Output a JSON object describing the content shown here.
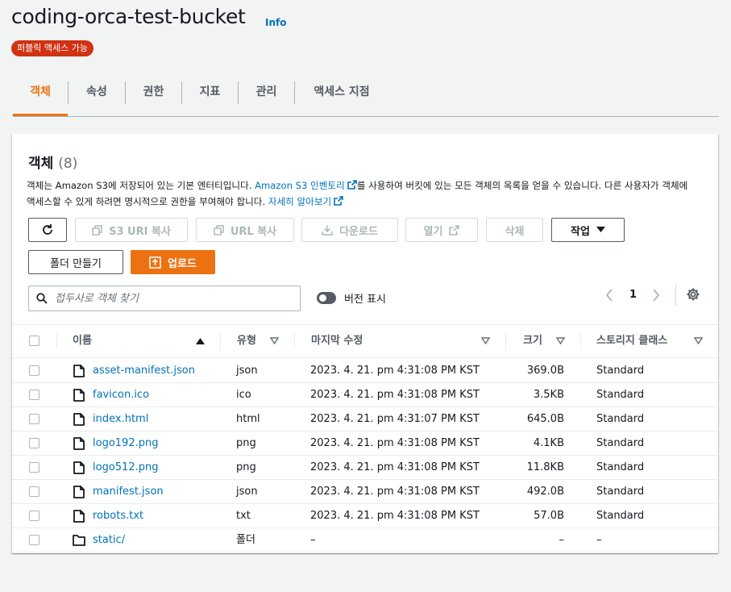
{
  "header": {
    "bucket_name": "coding-orca-test-bucket",
    "info_link": "Info",
    "public_badge": "퍼블릭 액세스 가능"
  },
  "tabs": [
    {
      "label": "객체",
      "active": true
    },
    {
      "label": "속성",
      "active": false
    },
    {
      "label": "권한",
      "active": false
    },
    {
      "label": "지표",
      "active": false
    },
    {
      "label": "관리",
      "active": false
    },
    {
      "label": "액세스 지점",
      "active": false
    }
  ],
  "panel": {
    "title": "객체",
    "count": "(8)",
    "desc_part1": "객체는 Amazon S3에 저장되어 있는 기본 엔터티입니다. ",
    "desc_link1": "Amazon S3 인벤토리",
    "desc_part2": "를 사용하여 버킷에 있는 모든 객체의 목록을 얻을 수 있습니다. 다른 사용자가 객체에 액세스할 수 있게 하려면 명시적으로 권한을 부여해야 합니다. ",
    "desc_link2": "자세히 알아보기"
  },
  "toolbar": {
    "refresh_label": "refresh",
    "copy_s3_uri": "S3 URI 복사",
    "copy_url": "URL 복사",
    "download": "다운로드",
    "open": "열기",
    "delete": "삭제",
    "actions": "작업",
    "create_folder": "폴더 만들기",
    "upload": "업로드"
  },
  "search": {
    "placeholder": "접두사로 객체 찾기",
    "value": ""
  },
  "version_toggle": {
    "label": "버전 표시",
    "on": false
  },
  "pagination": {
    "current_page": "1"
  },
  "table": {
    "columns": [
      "이름",
      "유형",
      "마지막 수정",
      "크기",
      "스토리지 클래스"
    ],
    "rows": [
      {
        "name": "asset-manifest.json",
        "type": "json",
        "modified": "2023. 4. 21. pm 4:31:08 PM KST",
        "size": "369.0B",
        "storage": "Standard",
        "kind": "file"
      },
      {
        "name": "favicon.ico",
        "type": "ico",
        "modified": "2023. 4. 21. pm 4:31:08 PM KST",
        "size": "3.5KB",
        "storage": "Standard",
        "kind": "file"
      },
      {
        "name": "index.html",
        "type": "html",
        "modified": "2023. 4. 21. pm 4:31:07 PM KST",
        "size": "645.0B",
        "storage": "Standard",
        "kind": "file"
      },
      {
        "name": "logo192.png",
        "type": "png",
        "modified": "2023. 4. 21. pm 4:31:08 PM KST",
        "size": "4.1KB",
        "storage": "Standard",
        "kind": "file"
      },
      {
        "name": "logo512.png",
        "type": "png",
        "modified": "2023. 4. 21. pm 4:31:08 PM KST",
        "size": "11.8KB",
        "storage": "Standard",
        "kind": "file"
      },
      {
        "name": "manifest.json",
        "type": "json",
        "modified": "2023. 4. 21. pm 4:31:08 PM KST",
        "size": "492.0B",
        "storage": "Standard",
        "kind": "file"
      },
      {
        "name": "robots.txt",
        "type": "txt",
        "modified": "2023. 4. 21. pm 4:31:08 PM KST",
        "size": "57.0B",
        "storage": "Standard",
        "kind": "file"
      },
      {
        "name": "static/",
        "type": "폴더",
        "modified": "–",
        "size": "–",
        "storage": "–",
        "kind": "folder"
      }
    ]
  },
  "colors": {
    "accent_orange": "#ec7211",
    "link_blue": "#0073bb",
    "badge_red": "#d13212",
    "text_dark": "#16191f",
    "text_muted": "#545b64"
  }
}
